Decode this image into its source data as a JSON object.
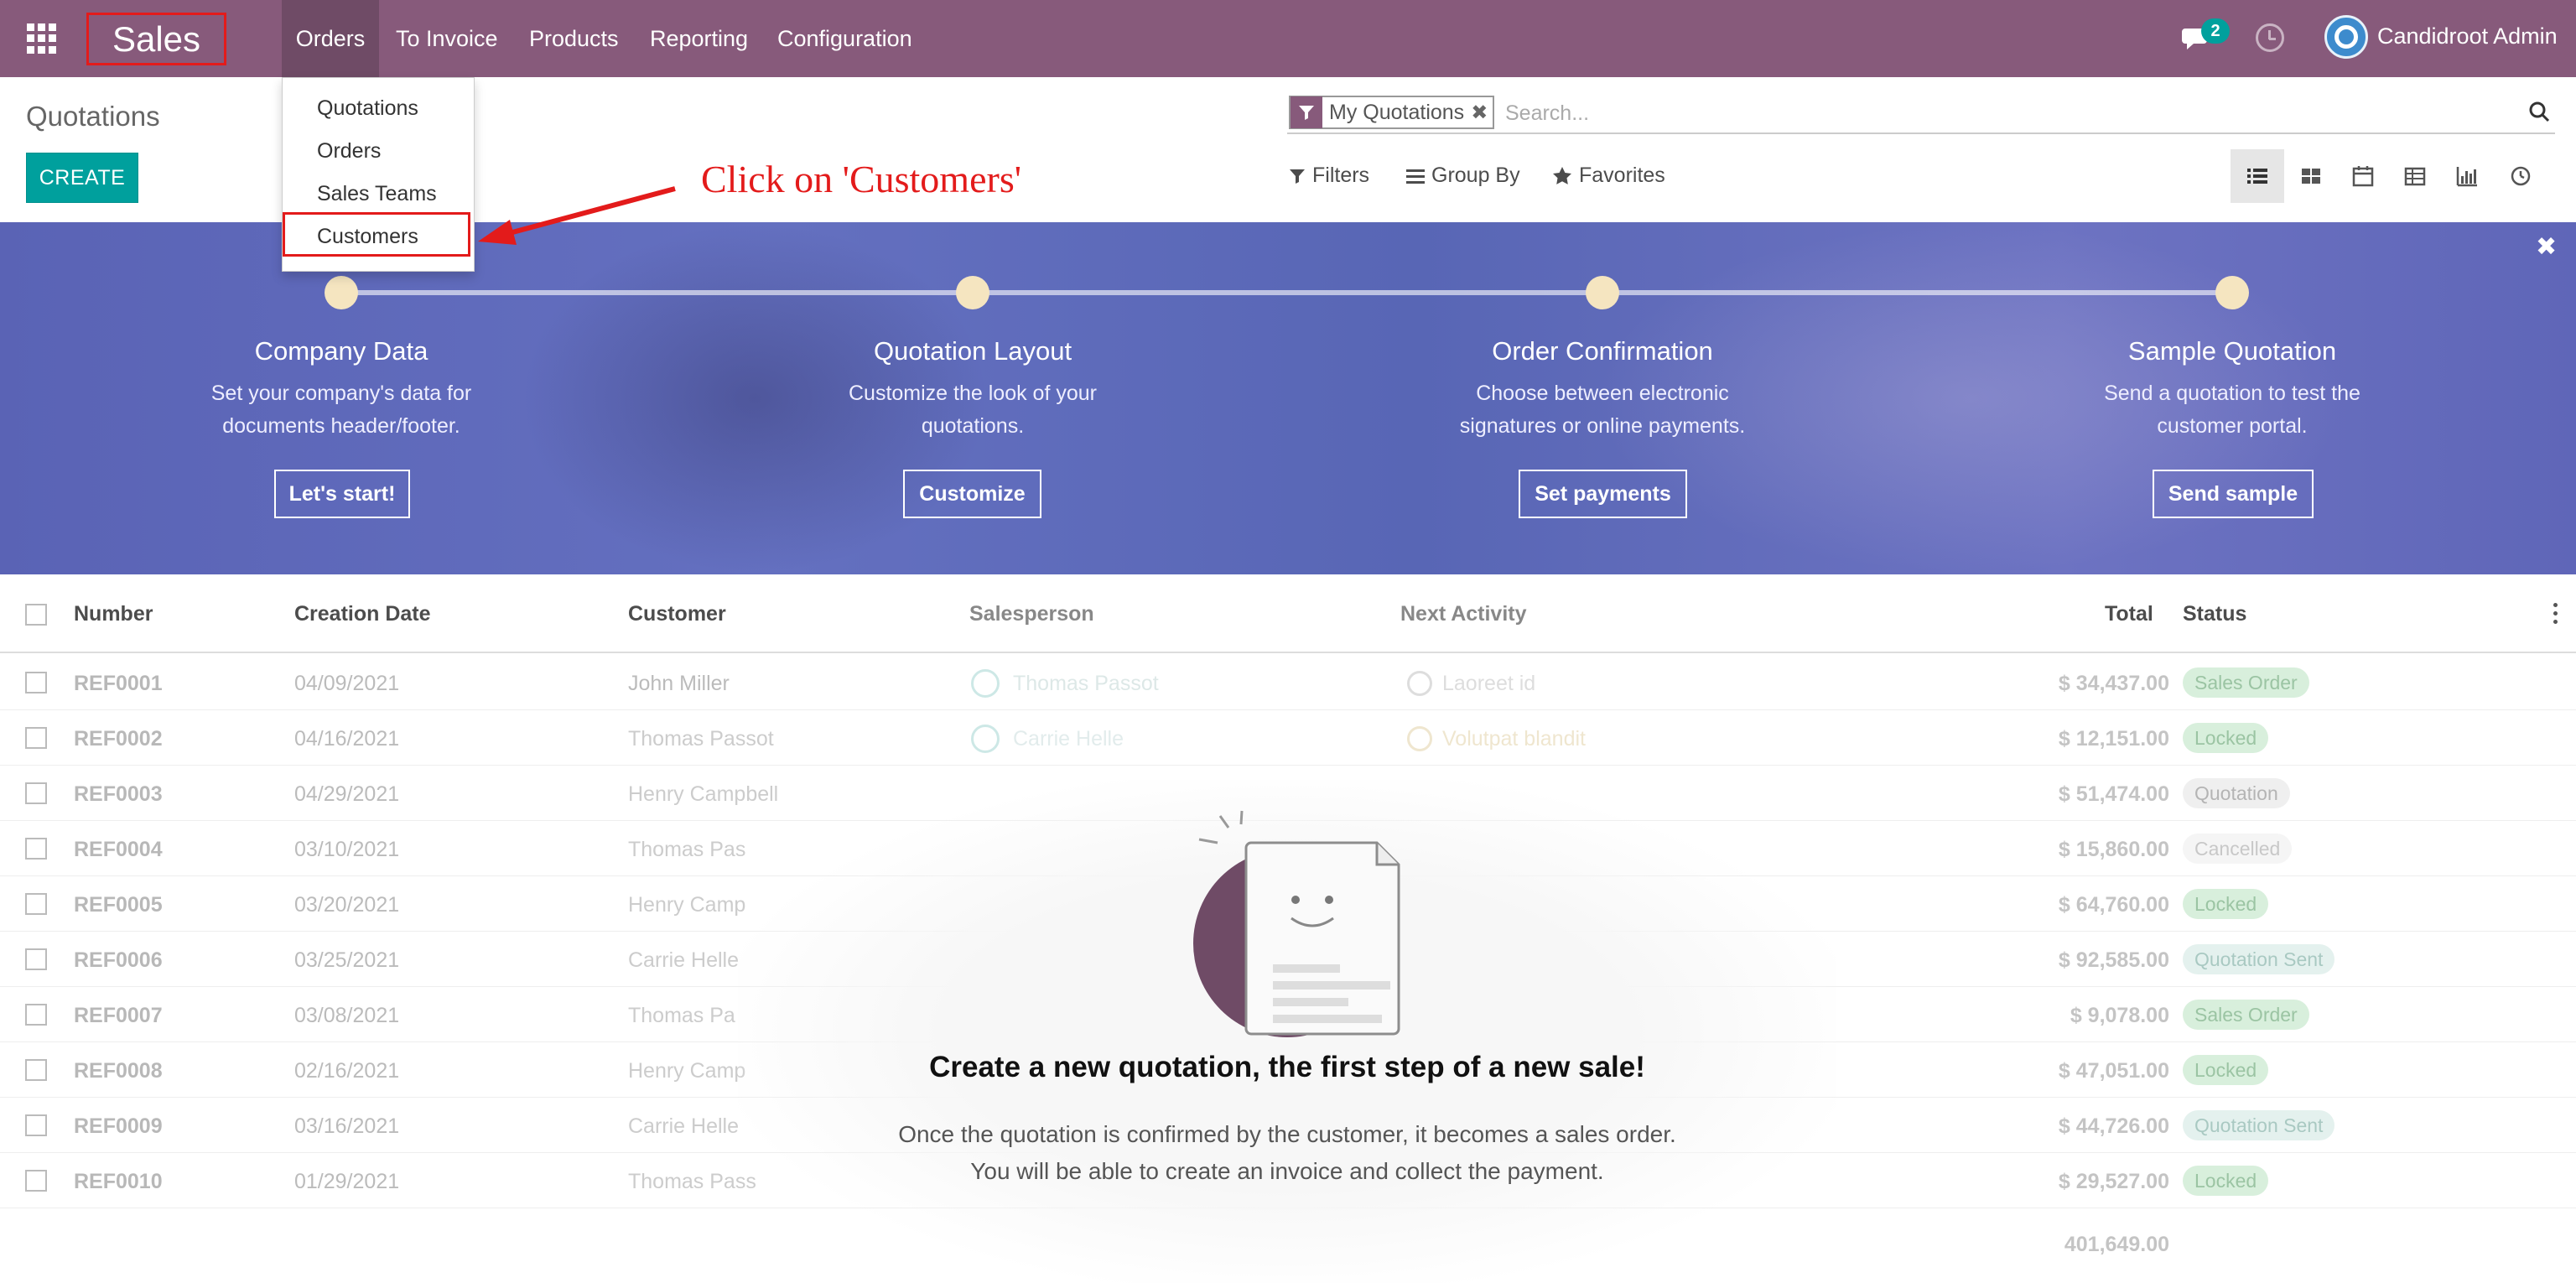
{
  "navbar": {
    "app_name": "Sales",
    "menu": [
      "Orders",
      "To Invoice",
      "Products",
      "Reporting",
      "Configuration"
    ],
    "chat_count": "2",
    "user_name": "Candidroot Admin"
  },
  "dropdown": {
    "items": [
      "Quotations",
      "Orders",
      "Sales Teams",
      "Customers"
    ]
  },
  "annotation": {
    "text": "Click on 'Customers'"
  },
  "control_panel": {
    "title": "Quotations",
    "create_label": "CREATE",
    "facet_label": "My Quotations",
    "search_placeholder": "Search...",
    "filters_label": "Filters",
    "groupby_label": "Group By",
    "favorites_label": "Favorites"
  },
  "banner": {
    "steps": [
      {
        "title": "Company Data",
        "desc": "Set your company's data for documents header/footer.",
        "button": "Let's start!"
      },
      {
        "title": "Quotation Layout",
        "desc": "Customize the look of your quotations.",
        "button": "Customize"
      },
      {
        "title": "Order Confirmation",
        "desc": "Choose between electronic signatures or online payments.",
        "button": "Set payments"
      },
      {
        "title": "Sample Quotation",
        "desc": "Send a quotation to test the customer portal.",
        "button": "Send sample"
      }
    ]
  },
  "table": {
    "headers": [
      "Number",
      "Creation Date",
      "Customer",
      "Salesperson",
      "Next Activity",
      "Total",
      "Status"
    ],
    "rows": [
      {
        "number": "REF0001",
        "date": "04/09/2021",
        "customer": "John Miller",
        "salesperson": "Thomas Passot",
        "activity": "Laoreet id",
        "total": "$ 34,437.00",
        "status": "Sales Order"
      },
      {
        "number": "REF0002",
        "date": "04/16/2021",
        "customer": "Thomas Passot",
        "salesperson": "Carrie Helle",
        "activity": "Volutpat blandit",
        "total": "$ 12,151.00",
        "status": "Locked"
      },
      {
        "number": "REF0003",
        "date": "04/29/2021",
        "customer": "Henry Campbell",
        "salesperson": "",
        "activity": "",
        "total": "$ 51,474.00",
        "status": "Quotation"
      },
      {
        "number": "REF0004",
        "date": "03/10/2021",
        "customer": "Thomas Pas",
        "salesperson": "",
        "activity": "",
        "total": "$ 15,860.00",
        "status": "Cancelled"
      },
      {
        "number": "REF0005",
        "date": "03/20/2021",
        "customer": "Henry Camp",
        "salesperson": "",
        "activity": "",
        "total": "$ 64,760.00",
        "status": "Locked"
      },
      {
        "number": "REF0006",
        "date": "03/25/2021",
        "customer": "Carrie Helle",
        "salesperson": "",
        "activity": "",
        "total": "$ 92,585.00",
        "status": "Quotation Sent"
      },
      {
        "number": "REF0007",
        "date": "03/08/2021",
        "customer": "Thomas Pa",
        "salesperson": "",
        "activity": "",
        "total": "$ 9,078.00",
        "status": "Sales Order"
      },
      {
        "number": "REF0008",
        "date": "02/16/2021",
        "customer": "Henry Camp",
        "salesperson": "",
        "activity": "",
        "total": "$ 47,051.00",
        "status": "Locked"
      },
      {
        "number": "REF0009",
        "date": "03/16/2021",
        "customer": "Carrie Helle",
        "salesperson": "",
        "activity": "",
        "total": "$ 44,726.00",
        "status": "Quotation Sent"
      },
      {
        "number": "REF0010",
        "date": "01/29/2021",
        "customer": "Thomas Pass",
        "salesperson": "",
        "activity": "",
        "total": "$ 29,527.00",
        "status": "Locked"
      }
    ],
    "sum_total": "401,649.00"
  },
  "empty_state": {
    "title": "Create a new quotation, the first step of a new sale!",
    "line1": "Once the quotation is confirmed by the customer, it becomes a sales order.",
    "line2": "You will be able to create an invoice and collect the payment."
  },
  "colors": {
    "navbar": "#875a7b",
    "primary": "#00a09d",
    "annotation": "#e31b1b",
    "banner": "#5a63b5"
  }
}
